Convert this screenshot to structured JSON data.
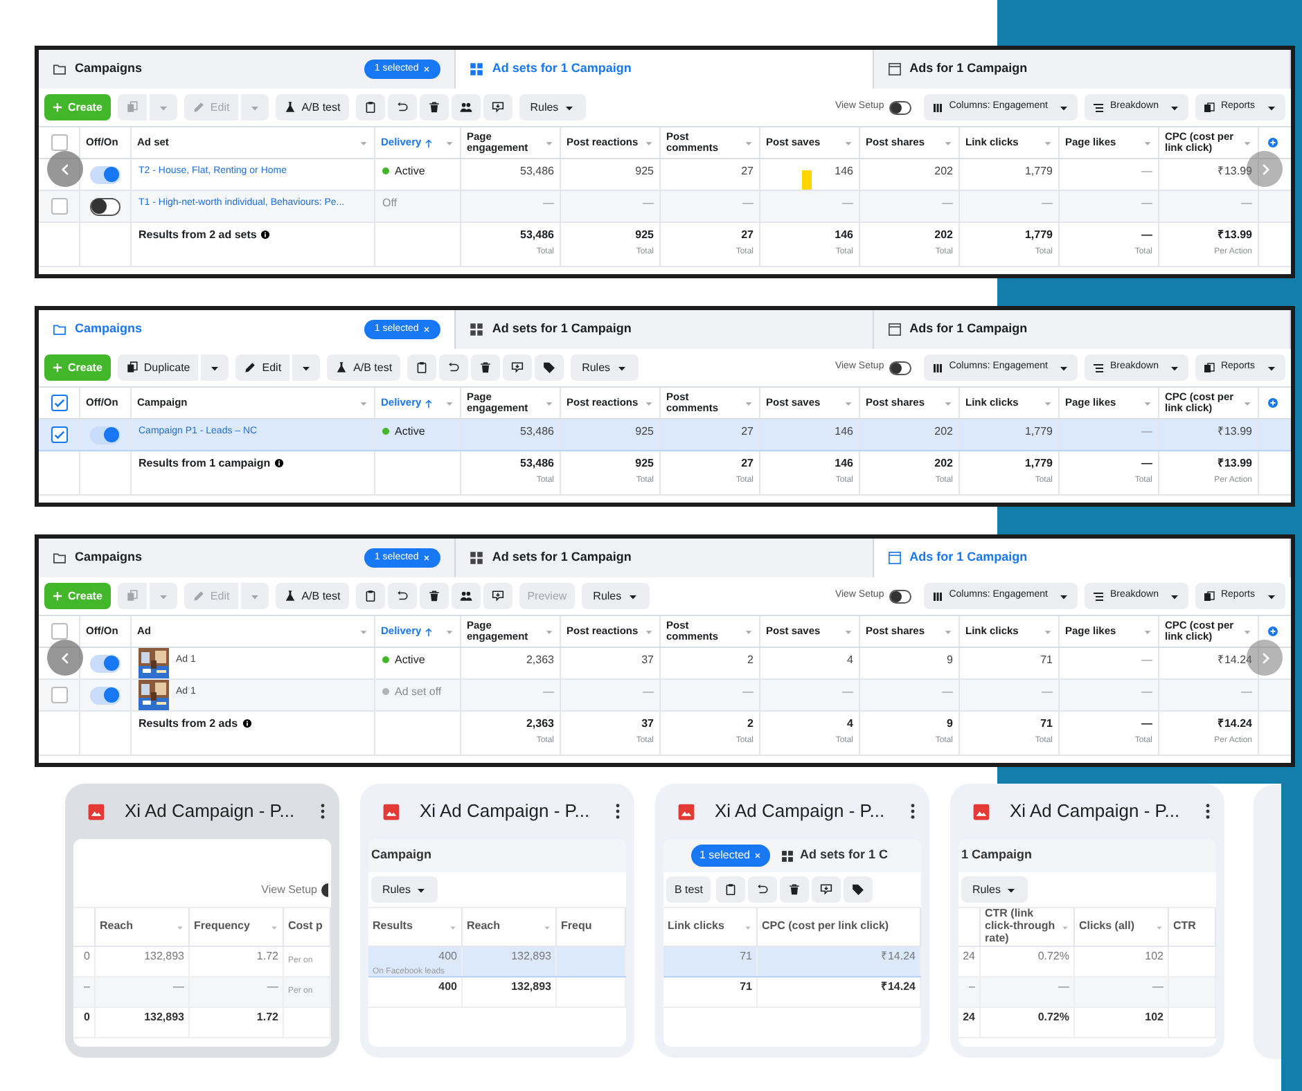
{
  "panels": [
    {
      "tabs": [
        {
          "label": "Campaigns",
          "badge": "1 selected",
          "selected": false
        },
        {
          "label": "Ad sets for 1 Campaign",
          "selected": true
        },
        {
          "label": "Ads for 1 Campaign",
          "selected": false
        }
      ],
      "toolbar": [
        {
          "kind": "create",
          "label": "Create"
        },
        {
          "kind": "duplicate",
          "disabled": true
        },
        {
          "kind": "edit",
          "label": "Edit",
          "disabled": true
        },
        {
          "kind": "ab_test",
          "label": "A/B test",
          "disabled": false
        },
        {
          "kind": "ad_actions"
        },
        {
          "kind": "rules",
          "label": "Rules"
        }
      ],
      "view_setup": {
        "label": "View Setup",
        "on": false
      },
      "menus": [
        {
          "label": "Columns: Engagement"
        },
        {
          "label": "Breakdown"
        },
        {
          "label": "Reports"
        }
      ],
      "header": {
        "checked": false,
        "toggle_label": "Off/On",
        "name_label": "Ad set",
        "delivery": {
          "label": "Delivery",
          "sorted": true
        },
        "metrics": [
          "Page engagement",
          "Post reactions",
          "Post comments",
          "Post saves",
          "Post shares",
          "Link clicks",
          "Page likes",
          "CPC (cost per link click)"
        ]
      },
      "rows": [
        {
          "on": true,
          "selected": false,
          "name": "T2 - House, Flat, Renting or Home",
          "delivery": {
            "label": "Active",
            "kind": "active"
          },
          "cells": [
            "53,486",
            "925",
            "27",
            {
              "value": "146",
              "marked": true
            },
            "202",
            "1,779",
            "—",
            "₹13.99"
          ]
        },
        {
          "checked": false,
          "on": false,
          "selected": false,
          "name": "T1 - High-net-worth individual, Behaviours: Pe...",
          "delivery": {
            "label": "Off",
            "kind": "off"
          },
          "cells": [
            "—",
            "—",
            "—",
            "—",
            "—",
            "—",
            "—",
            "—"
          ]
        }
      ],
      "total": {
        "label": "Results from 2 ad sets",
        "cells": [
          {
            "value": "53,486",
            "sub": "Total"
          },
          {
            "value": "925",
            "sub": "Total"
          },
          {
            "value": "27",
            "sub": "Total"
          },
          {
            "value": "146",
            "sub": "Total"
          },
          {
            "value": "202",
            "sub": "Total"
          },
          {
            "value": "1,779",
            "sub": "Total"
          },
          {
            "value": "—",
            "sub": "Total"
          },
          {
            "value": "₹13.99",
            "sub": "Per Action"
          }
        ]
      },
      "nav_arrows": true
    },
    {
      "tabs": [
        {
          "label": "Campaigns",
          "badge": "1 selected",
          "selected": true
        },
        {
          "label": "Ad sets for 1 Campaign",
          "selected": false
        },
        {
          "label": "Ads for 1 Campaign",
          "selected": false
        }
      ],
      "toolbar": [
        {
          "kind": "create",
          "label": "Create"
        },
        {
          "kind": "duplicate",
          "label": "Duplicate",
          "disabled": false
        },
        {
          "kind": "edit",
          "label": "Edit",
          "disabled": false
        },
        {
          "kind": "ab_test",
          "label": "A/B test",
          "disabled": false
        },
        {
          "kind": "campaign_actions"
        },
        {
          "kind": "rules",
          "label": "Rules"
        }
      ],
      "view_setup": {
        "label": "View Setup",
        "on": false
      },
      "menus": [
        {
          "label": "Columns: Engagement"
        },
        {
          "label": "Breakdown"
        },
        {
          "label": "Reports"
        }
      ],
      "header": {
        "checked": true,
        "toggle_label": "Off/On",
        "name_label": "Campaign",
        "delivery": {
          "label": "Delivery",
          "sorted": true
        },
        "metrics": [
          "Page engagement",
          "Post reactions",
          "Post comments",
          "Post saves",
          "Post shares",
          "Link clicks",
          "Page likes",
          "CPC (cost per link click)"
        ]
      },
      "rows": [
        {
          "checked": true,
          "on": true,
          "selected": true,
          "name": "Campaign P1 - Leads – NC",
          "delivery": {
            "label": "Active",
            "kind": "active"
          },
          "cells": [
            "53,486",
            "925",
            "27",
            "146",
            "202",
            "1,779",
            "—",
            "₹13.99"
          ]
        }
      ],
      "total": {
        "label": "Results from 1 campaign",
        "cells": [
          {
            "value": "53,486",
            "sub": "Total"
          },
          {
            "value": "925",
            "sub": "Total"
          },
          {
            "value": "27",
            "sub": "Total"
          },
          {
            "value": "146",
            "sub": "Total"
          },
          {
            "value": "202",
            "sub": "Total"
          },
          {
            "value": "1,779",
            "sub": "Total"
          },
          {
            "value": "—",
            "sub": "Total"
          },
          {
            "value": "₹13.99",
            "sub": "Per Action"
          }
        ]
      },
      "nav_arrows": false
    },
    {
      "tabs": [
        {
          "label": "Campaigns",
          "badge": "1 selected",
          "selected": false
        },
        {
          "label": "Ad sets for 1 Campaign",
          "selected": false
        },
        {
          "label": "Ads for 1 Campaign",
          "selected": true
        }
      ],
      "toolbar": [
        {
          "kind": "create",
          "label": "Create"
        },
        {
          "kind": "duplicate",
          "disabled": true
        },
        {
          "kind": "edit",
          "label": "Edit",
          "disabled": true
        },
        {
          "kind": "ab_test",
          "label": "A/B test",
          "disabled": false
        },
        {
          "kind": "ad_actions"
        },
        {
          "kind": "button",
          "label": "Preview",
          "disabled": true
        },
        {
          "kind": "rules",
          "label": "Rules"
        }
      ],
      "view_setup": {
        "label": "View Setup",
        "on": false
      },
      "menus": [
        {
          "label": "Columns: Engagement"
        },
        {
          "label": "Breakdown"
        },
        {
          "label": "Reports"
        }
      ],
      "header": {
        "checked": false,
        "toggle_label": "Off/On",
        "name_label": "Ad",
        "delivery": {
          "label": "Delivery",
          "sorted": true
        },
        "metrics": [
          "Page engagement",
          "Post reactions",
          "Post comments",
          "Post saves",
          "Post shares",
          "Link clicks",
          "Page likes",
          "CPC (cost per link click)"
        ]
      },
      "rows": [
        {
          "on": true,
          "selected": false,
          "name": "Ad 1",
          "delivery": {
            "label": "Active",
            "kind": "active"
          },
          "cells": [
            "2,363",
            "37",
            "2",
            "4",
            "9",
            "71",
            "—",
            "₹14.24"
          ]
        },
        {
          "checked": false,
          "on": true,
          "selected": false,
          "name": "Ad 1",
          "delivery": {
            "label": "Ad set off",
            "kind": "inactive"
          },
          "cells": [
            "—",
            "—",
            "—",
            "—",
            "—",
            "—",
            "—",
            "—"
          ]
        }
      ],
      "total": {
        "label": "Results from 2 ads",
        "cells": [
          {
            "value": "2,363",
            "sub": "Total"
          },
          {
            "value": "37",
            "sub": "Total"
          },
          {
            "value": "2",
            "sub": "Total"
          },
          {
            "value": "4",
            "sub": "Total"
          },
          {
            "value": "9",
            "sub": "Total"
          },
          {
            "value": "71",
            "sub": "Total"
          },
          {
            "value": "—",
            "sub": "Total"
          },
          {
            "value": "₹14.24",
            "sub": "Per Action"
          }
        ]
      },
      "nav_arrows": true
    }
  ],
  "cards": [
    {
      "title": "Xi Ad Campaign - P...",
      "selected": true,
      "toolbar": [
        {
          "kind": "view_setup",
          "label": "View Setup",
          "on": false
        }
      ],
      "columns": [
        {
          "partial": true
        },
        {
          "label": "Reach"
        },
        {
          "label": "Frequency"
        },
        {
          "label": "Cost p"
        }
      ],
      "rows": [
        {
          "selected": false,
          "bold": false,
          "cells": [
            {
              "value": "0"
            },
            {
              "value": "132,893"
            },
            {
              "value": "1.72"
            },
            {
              "sub": "Per on"
            }
          ]
        },
        {
          "selected": false,
          "bold": false,
          "cells": [
            {
              "value": "–"
            },
            {
              "value": "—"
            },
            {
              "value": "—"
            },
            {
              "sub": "Per on"
            }
          ]
        },
        {
          "selected": false,
          "bold": true,
          "cells": [
            {
              "value": "0"
            },
            {
              "value": "132,893"
            },
            {
              "value": "1.72"
            },
            {}
          ]
        }
      ]
    },
    {
      "title": "Xi Ad Campaign - P...",
      "selected": false,
      "strip": [
        {
          "kind": "tab",
          "label": "Campaign"
        }
      ],
      "toolbar": [
        {
          "kind": "rules",
          "label": "Rules"
        }
      ],
      "columns": [
        {
          "label": "Results"
        },
        {
          "label": "Reach"
        },
        {
          "label": "Frequ"
        }
      ],
      "rows": [
        {
          "selected": true,
          "bold": false,
          "cells": [
            {
              "value": "400",
              "sub": "On Facebook leads"
            },
            {
              "value": "132,893"
            },
            {}
          ]
        },
        {
          "selected": false,
          "bold": true,
          "cells": [
            {
              "value": "400"
            },
            {
              "value": "132,893"
            },
            {}
          ]
        }
      ]
    },
    {
      "title": "Xi Ad Campaign - P...",
      "selected": false,
      "strip": [
        {
          "kind": "badge",
          "label": "1 selected"
        },
        {
          "kind": "adsets_tab",
          "label": "Ad sets for 1 C"
        }
      ],
      "toolbar": [
        {
          "kind": "button",
          "label": "B test",
          "disabled": false
        },
        {
          "kind": "campaign_actions"
        }
      ],
      "columns": [
        {
          "label": "Link clicks"
        },
        {
          "label": "CPC (cost per link click)"
        }
      ],
      "rows": [
        {
          "selected": true,
          "bold": false,
          "cells": [
            {
              "value": "71"
            },
            {
              "value": "₹14.24"
            }
          ]
        },
        {
          "selected": false,
          "bold": true,
          "cells": [
            {
              "value": "71"
            },
            {
              "value": "₹14.24"
            }
          ]
        }
      ]
    },
    {
      "title": "Xi Ad Campaign - P...",
      "selected": false,
      "strip": [
        {
          "kind": "tab",
          "label": "1 Campaign"
        }
      ],
      "toolbar": [
        {
          "kind": "rules",
          "label": "Rules"
        }
      ],
      "columns": [
        {
          "partial": true
        },
        {
          "label": "CTR (link click-through rate)"
        },
        {
          "label": "Clicks (all)"
        },
        {
          "label": "CTR"
        }
      ],
      "rows": [
        {
          "selected": false,
          "bold": false,
          "cells": [
            {
              "value": "24"
            },
            {
              "value": "0.72%"
            },
            {
              "value": "102"
            },
            {}
          ]
        },
        {
          "selected": false,
          "bold": false,
          "cells": [
            {
              "value": "–"
            },
            {
              "value": "—"
            },
            {
              "value": "—"
            },
            {}
          ]
        },
        {
          "selected": false,
          "bold": true,
          "cells": [
            {
              "value": "24"
            },
            {
              "value": "0.72%"
            },
            {
              "value": "102"
            },
            {}
          ]
        }
      ]
    }
  ]
}
